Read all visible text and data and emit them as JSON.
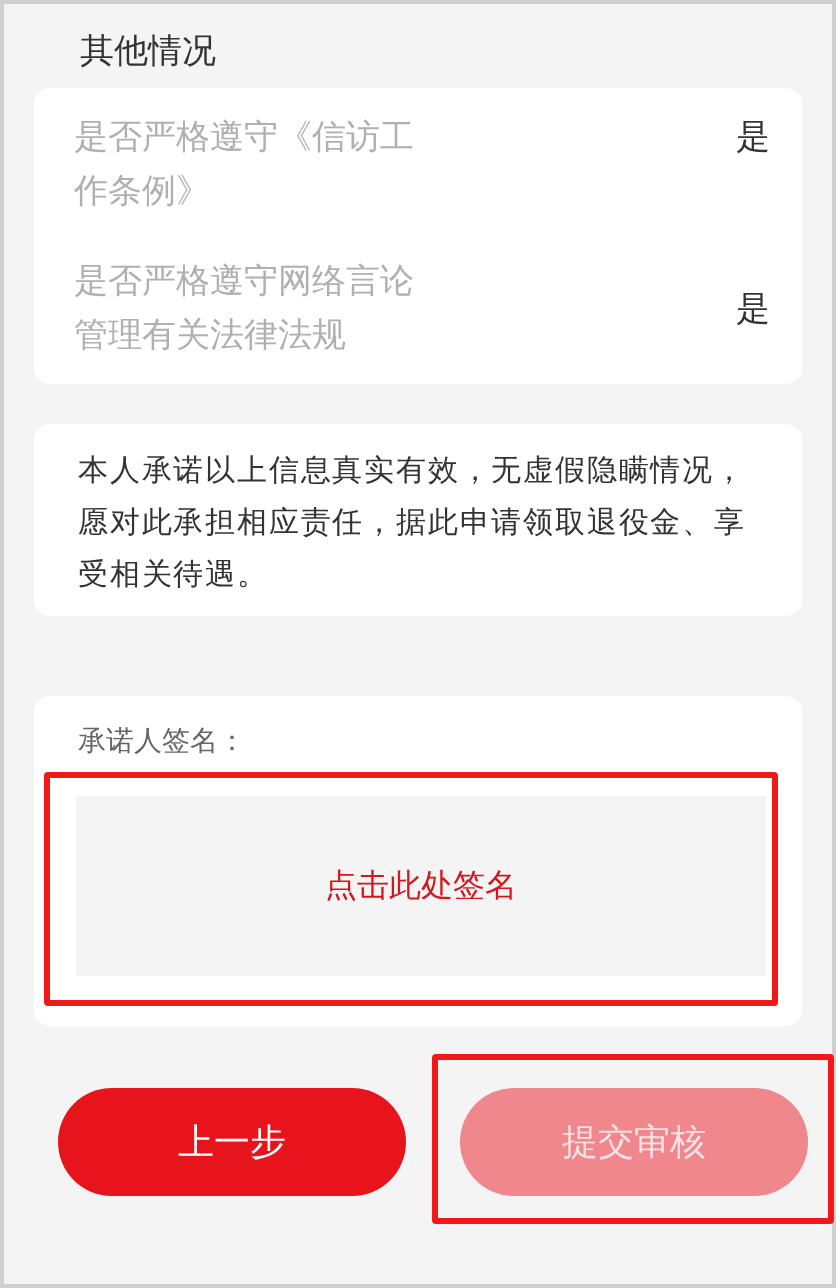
{
  "section_title": "其他情况",
  "items": [
    {
      "label": "是否严格遵守《信访工作条例》",
      "value": "是"
    },
    {
      "label": "是否严格遵守网络言论管理有关法律法规",
      "value": "是"
    }
  ],
  "declaration": "本人承诺以上信息真实有效，无虚假隐瞒情况，愿对此承担相应责任，据此申请领取退役金、享受相关待遇。",
  "signature": {
    "label": "承诺人签名：",
    "prompt": "点击此处签名",
    "highlighted": true
  },
  "buttons": [
    {
      "label": "上一步",
      "disabled": false,
      "highlighted": false
    },
    {
      "label": "提交审核",
      "disabled": true,
      "highlighted": true
    }
  ]
}
